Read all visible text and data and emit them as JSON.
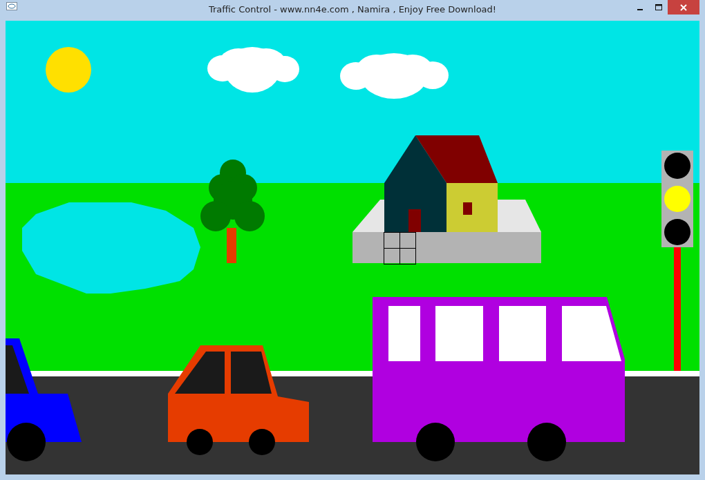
{
  "window": {
    "title": "Traffic Control - www.nn4e.com , Namira , Enjoy Free Download!"
  },
  "traffic_light": {
    "lights": [
      {
        "on": false
      },
      {
        "on": true
      },
      {
        "on": false
      }
    ]
  }
}
